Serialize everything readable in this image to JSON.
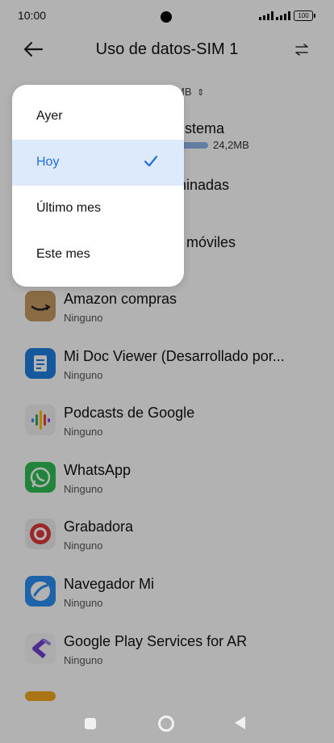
{
  "status": {
    "time": "10:00",
    "battery": "100"
  },
  "header": {
    "title": "Uso de datos-SIM 1"
  },
  "background": {
    "range_fragment": "MB",
    "row1_fragment": "sistema",
    "row1_value": "24,2MB",
    "row2_fragment": "minadas",
    "row3_fragment": "o móviles"
  },
  "menu": {
    "items": [
      {
        "label": "Ayer"
      },
      {
        "label": "Hoy"
      },
      {
        "label": "Último mes"
      },
      {
        "label": "Este mes"
      }
    ],
    "selected": "Hoy"
  },
  "apps": [
    {
      "name": "Amazon compras",
      "status": "Ninguno",
      "icon": "amazon-icon"
    },
    {
      "name": "Mi Doc Viewer (Desarrollado por...",
      "status": "Ninguno",
      "icon": "document-viewer-icon"
    },
    {
      "name": "Podcasts de Google",
      "status": "Ninguno",
      "icon": "podcasts-icon"
    },
    {
      "name": "WhatsApp",
      "status": "Ninguno",
      "icon": "whatsapp-icon"
    },
    {
      "name": "Grabadora",
      "status": "Ninguno",
      "icon": "recorder-icon"
    },
    {
      "name": "Navegador Mi",
      "status": "Ninguno",
      "icon": "browser-icon"
    },
    {
      "name": "Google Play Services for AR",
      "status": "Ninguno",
      "icon": "arcore-icon"
    }
  ],
  "colors": {
    "accent": "#1f6fe0",
    "selected_bg": "#dceafb"
  }
}
